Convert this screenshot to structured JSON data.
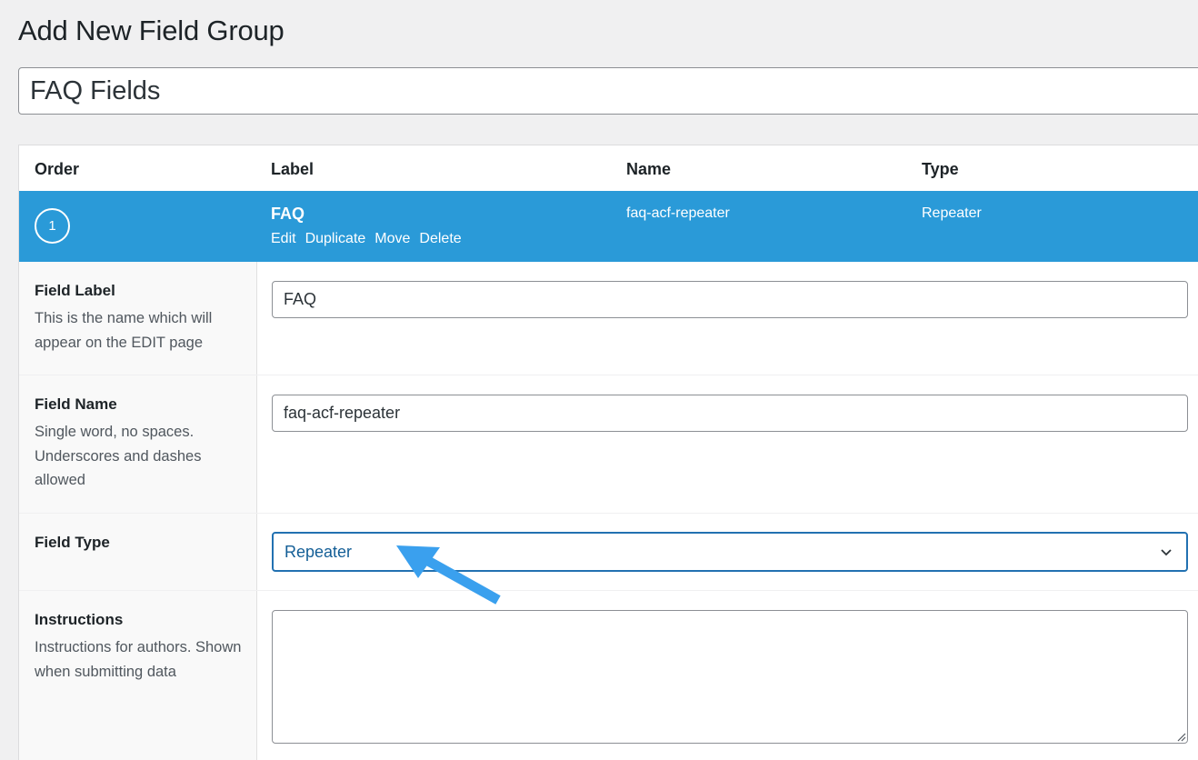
{
  "page": {
    "title": "Add New Field Group"
  },
  "group_title": {
    "value": "FAQ Fields"
  },
  "table": {
    "headers": {
      "order": "Order",
      "label": "Label",
      "name": "Name",
      "type": "Type"
    },
    "row": {
      "order": "1",
      "label": "FAQ",
      "name": "faq-acf-repeater",
      "type": "Repeater",
      "actions": {
        "edit": "Edit",
        "duplicate": "Duplicate",
        "move": "Move",
        "delete": "Delete"
      }
    }
  },
  "settings": {
    "field_label": {
      "label": "Field Label",
      "description": "This is the name which will appear on the EDIT page",
      "value": "FAQ"
    },
    "field_name": {
      "label": "Field Name",
      "description": "Single word, no spaces. Underscores and dashes allowed",
      "value": "faq-acf-repeater"
    },
    "field_type": {
      "label": "Field Type",
      "selected": "Repeater"
    },
    "instructions": {
      "label": "Instructions",
      "description": "Instructions for authors. Shown when submitting data",
      "value": ""
    }
  },
  "colors": {
    "row_highlight": "#2a9ad8",
    "select_focus": "#2271b1",
    "arrow": "#3aa0ee"
  },
  "icons": [
    "chevron-down-icon",
    "pointer-arrow-icon",
    "resize-grip-icon"
  ]
}
